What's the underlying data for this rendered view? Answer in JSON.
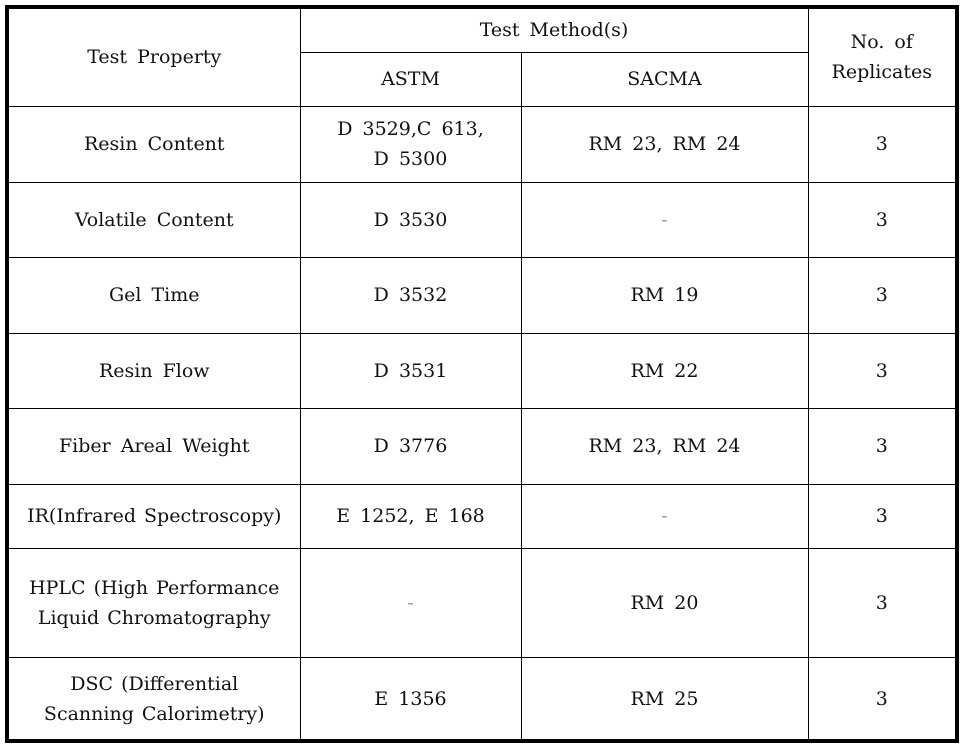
{
  "table": {
    "headers": {
      "test_property": "Test Property",
      "test_methods": "Test Method(s)",
      "astm": "ASTM",
      "sacma": "SACMA",
      "replicates": "No. of\nReplicates"
    },
    "rows": [
      {
        "property": "Resin Content",
        "astm": "D 3529,C 613,\nD 5300",
        "sacma": "RM 23, RM 24",
        "replicates": "3"
      },
      {
        "property": "Volatile Content",
        "astm": "D 3530",
        "sacma": "-",
        "replicates": "3"
      },
      {
        "property": "Gel Time",
        "astm": "D 3532",
        "sacma": "RM 19",
        "replicates": "3"
      },
      {
        "property": "Resin Flow",
        "astm": "D 3531",
        "sacma": "RM 22",
        "replicates": "3"
      },
      {
        "property": "Fiber Areal Weight",
        "astm": "D 3776",
        "sacma": "RM 23, RM 24",
        "replicates": "3"
      },
      {
        "property": "IR(Infrared Spectroscopy)",
        "astm": "E 1252, E 168",
        "sacma": "-",
        "replicates": "3"
      },
      {
        "property": "HPLC (High Performance\nLiquid Chromatography",
        "astm": "-",
        "sacma": "RM 20",
        "replicates": "3"
      },
      {
        "property": "DSC (Differential\nScanning Calorimetry)",
        "astm": "E 1356",
        "sacma": "RM 25",
        "replicates": "3"
      }
    ]
  }
}
